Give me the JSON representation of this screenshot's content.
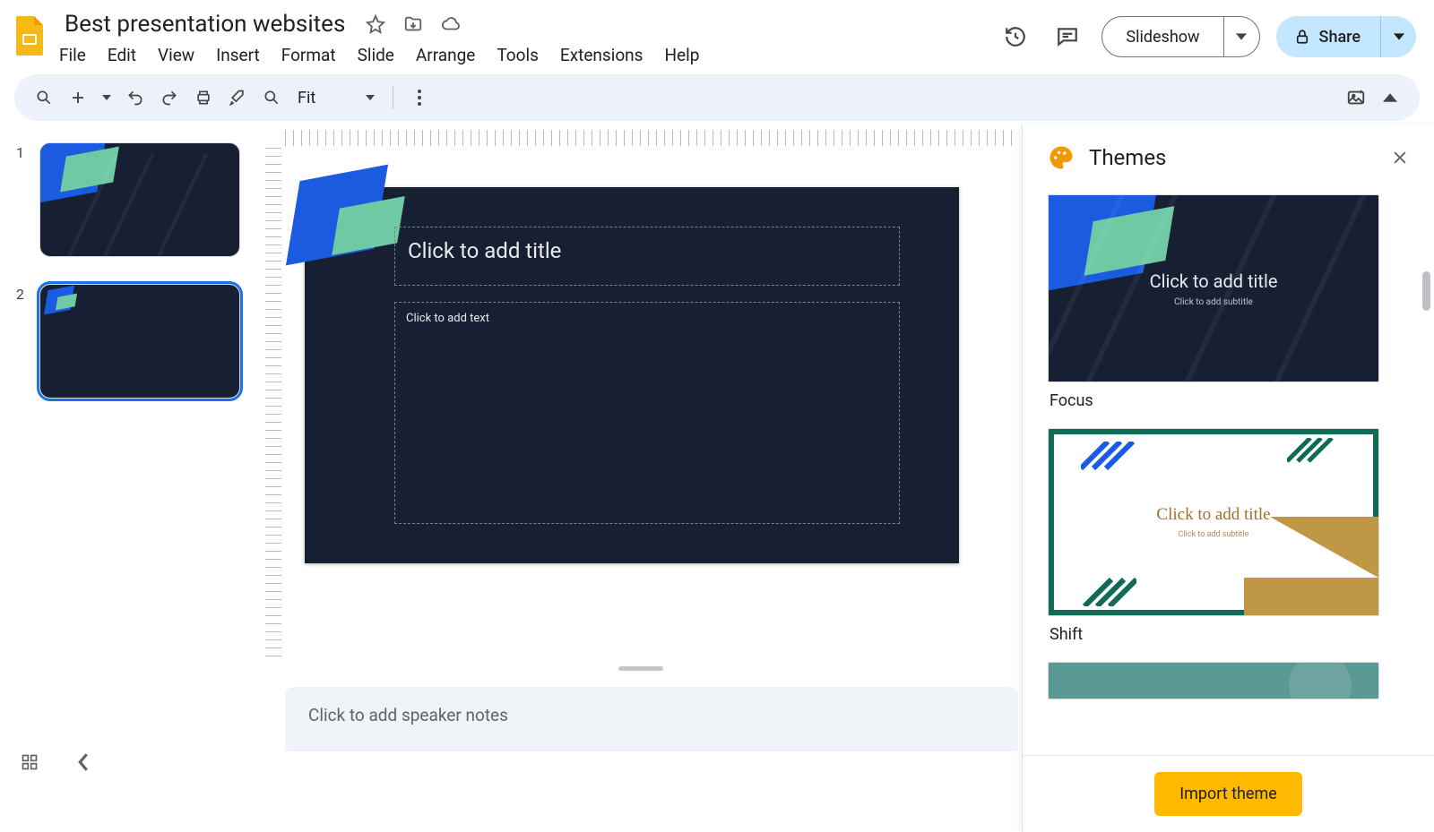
{
  "doc": {
    "title": "Best presentation websites"
  },
  "menu": {
    "file": "File",
    "edit": "Edit",
    "view": "View",
    "insert": "Insert",
    "format": "Format",
    "slide": "Slide",
    "arrange": "Arrange",
    "tools": "Tools",
    "extensions": "Extensions",
    "help": "Help"
  },
  "header_actions": {
    "slideshow": "Slideshow",
    "share": "Share"
  },
  "toolbar": {
    "zoom_label": "Fit"
  },
  "filmstrip": {
    "slides": [
      {
        "num": "1"
      },
      {
        "num": "2"
      }
    ],
    "selected_index": 1
  },
  "canvas": {
    "title_placeholder": "Click to add title",
    "body_placeholder": "Click to add text",
    "notes_placeholder": "Click to add speaker notes"
  },
  "themes_panel": {
    "header": "Themes",
    "preview_title": "Click to add title",
    "preview_sub": "Click to add subtitle",
    "themes": [
      {
        "name": "Focus"
      },
      {
        "name": "Shift"
      }
    ],
    "import_label": "Import theme"
  }
}
